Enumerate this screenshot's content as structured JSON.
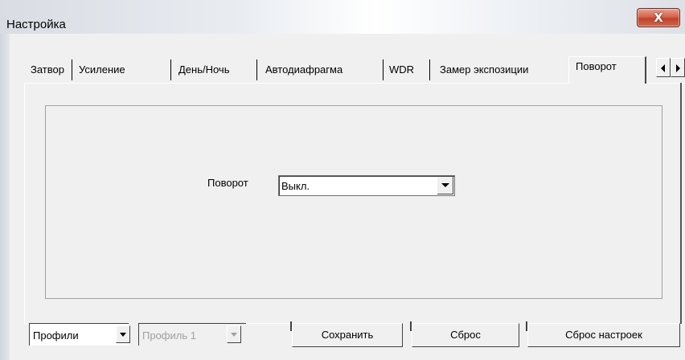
{
  "window": {
    "title": "Настройка",
    "close_glyph": "X"
  },
  "tabs": [
    {
      "label": "Затвор",
      "active": false
    },
    {
      "label": "Усиление",
      "active": false
    },
    {
      "label": "День/Ночь",
      "active": false
    },
    {
      "label": "Автодиафрагма",
      "active": false
    },
    {
      "label": "WDR",
      "active": false
    },
    {
      "label": "Замер экспозиции",
      "active": false
    },
    {
      "label": "Поворот",
      "active": true
    }
  ],
  "tab_scroll": {
    "left_icon": "scroll-left-icon",
    "right_icon": "scroll-right-icon"
  },
  "rotation": {
    "label": "Поворот",
    "value": "Выкл."
  },
  "bottom": {
    "profiles_combo": "Профили",
    "profile_combo": "Профиль 1",
    "profile_combo_disabled": true,
    "save_label": "Сохранить",
    "reset_label": "Сброс",
    "reset_settings_label": "Сброс настроек"
  },
  "colors": {
    "close_button": "#c94a32",
    "disabled_text": "#a0a0a0"
  }
}
